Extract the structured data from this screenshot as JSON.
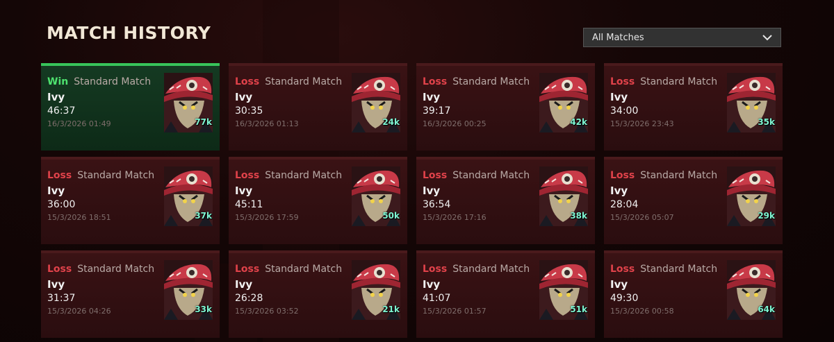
{
  "header": {
    "title": "MATCH HISTORY"
  },
  "filter": {
    "selected": "All Matches"
  },
  "matches": [
    {
      "result": "Win",
      "mode": "Standard Match",
      "hero": "Ivy",
      "duration": "46:37",
      "date": "16/3/2026 01:49",
      "score": "77k"
    },
    {
      "result": "Loss",
      "mode": "Standard Match",
      "hero": "Ivy",
      "duration": "30:35",
      "date": "16/3/2026 01:13",
      "score": "24k"
    },
    {
      "result": "Loss",
      "mode": "Standard Match",
      "hero": "Ivy",
      "duration": "39:17",
      "date": "16/3/2026 00:25",
      "score": "42k"
    },
    {
      "result": "Loss",
      "mode": "Standard Match",
      "hero": "Ivy",
      "duration": "34:00",
      "date": "15/3/2026 23:43",
      "score": "35k"
    },
    {
      "result": "Loss",
      "mode": "Standard Match",
      "hero": "Ivy",
      "duration": "36:00",
      "date": "15/3/2026 18:51",
      "score": "37k"
    },
    {
      "result": "Loss",
      "mode": "Standard Match",
      "hero": "Ivy",
      "duration": "45:11",
      "date": "15/3/2026 17:59",
      "score": "50k"
    },
    {
      "result": "Loss",
      "mode": "Standard Match",
      "hero": "Ivy",
      "duration": "36:54",
      "date": "15/3/2026 17:16",
      "score": "38k"
    },
    {
      "result": "Loss",
      "mode": "Standard Match",
      "hero": "Ivy",
      "duration": "28:04",
      "date": "15/3/2026 05:07",
      "score": "29k"
    },
    {
      "result": "Loss",
      "mode": "Standard Match",
      "hero": "Ivy",
      "duration": "31:37",
      "date": "15/3/2026 04:26",
      "score": "33k"
    },
    {
      "result": "Loss",
      "mode": "Standard Match",
      "hero": "Ivy",
      "duration": "26:28",
      "date": "15/3/2026 03:52",
      "score": "21k"
    },
    {
      "result": "Loss",
      "mode": "Standard Match",
      "hero": "Ivy",
      "duration": "41:07",
      "date": "15/3/2026 01:57",
      "score": "51k"
    },
    {
      "result": "Loss",
      "mode": "Standard Match",
      "hero": "Ivy",
      "duration": "49:30",
      "date": "15/3/2026 00:58",
      "score": "64k"
    }
  ],
  "colors": {
    "win": "#4ee26f",
    "loss": "#e0424a",
    "score": "#7ff5d2"
  },
  "icons": {
    "filter": "chevron-down-icon",
    "portrait": "hero-portrait-icon"
  }
}
